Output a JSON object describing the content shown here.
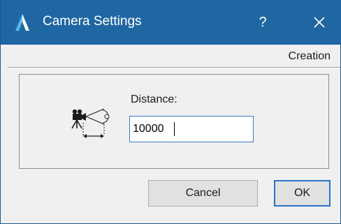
{
  "window": {
    "title": "Camera Settings",
    "help_glyph": "?",
    "icons": {
      "app": "archicad-app-icon",
      "close": "close-icon",
      "camera": "camera-distance-icon"
    },
    "colors": {
      "titlebar": "#1f67a3",
      "focus_border": "#2a73c8"
    }
  },
  "category_label": "Creation",
  "distance": {
    "label": "Distance:",
    "value": "10000"
  },
  "buttons": {
    "cancel": "Cancel",
    "ok": "OK"
  }
}
